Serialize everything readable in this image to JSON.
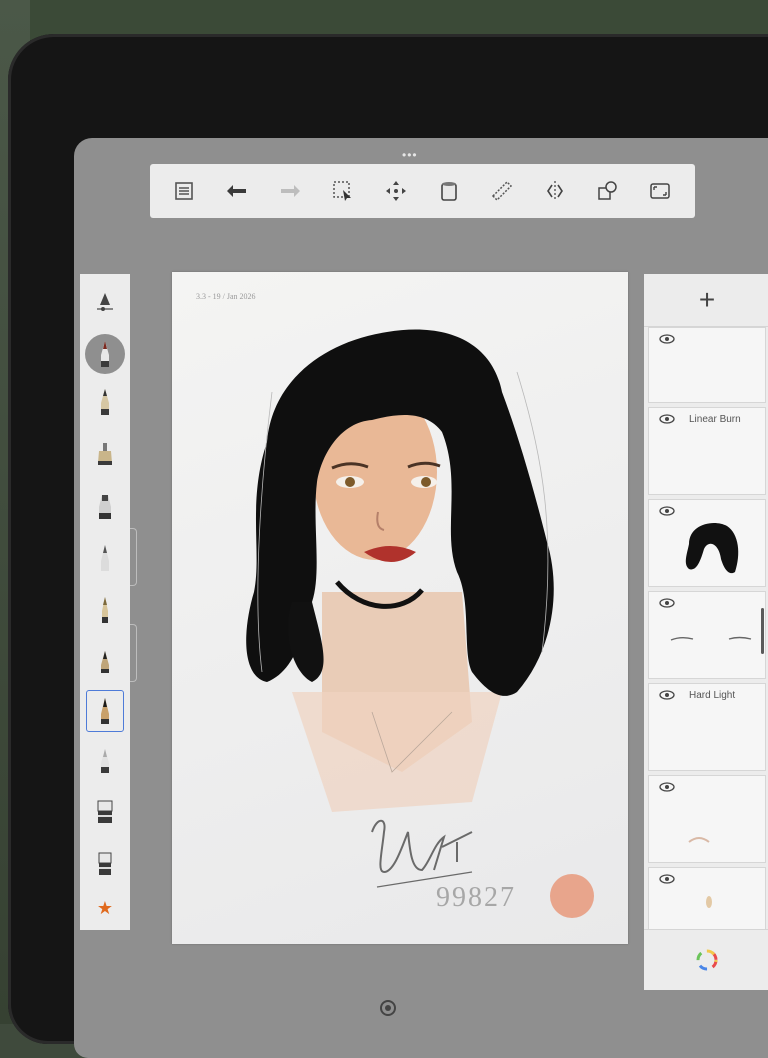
{
  "app": {
    "grab_indicator": "•••"
  },
  "toolbar": {
    "items": [
      {
        "name": "lists-icon"
      },
      {
        "name": "undo-icon"
      },
      {
        "name": "redo-icon"
      },
      {
        "name": "selection-icon"
      },
      {
        "name": "transform-icon"
      },
      {
        "name": "fill-bucket-icon"
      },
      {
        "name": "ruler-icon"
      },
      {
        "name": "symmetry-icon"
      },
      {
        "name": "shapes-icon"
      },
      {
        "name": "fullscreen-icon"
      }
    ]
  },
  "brushes": {
    "items": [
      "brush-settings",
      "pencil-active",
      "pencil",
      "airbrush",
      "marker",
      "pen",
      "ballpoint",
      "paint-brush",
      "inking-brush-selected",
      "smudge",
      "eraser",
      "bucket-eraser"
    ],
    "favorite_icon": "star-icon"
  },
  "canvas": {
    "date_note": "3.3 - 19 / Jan 2026",
    "signature": "Urs",
    "signature_number": "99827",
    "swatch_color": "#e8a58c"
  },
  "layers": {
    "add_label": "+",
    "items": [
      {
        "mode": "",
        "thumb": "blank"
      },
      {
        "mode": "Linear Burn",
        "thumb": "blank"
      },
      {
        "mode": "",
        "thumb": "hair"
      },
      {
        "mode": "",
        "thumb": "brows"
      },
      {
        "mode": "Hard Light",
        "thumb": "blank"
      },
      {
        "mode": "",
        "thumb": "faint"
      },
      {
        "mode": "",
        "thumb": "faint"
      }
    ],
    "color_button_icon": "color-wheel-icon"
  },
  "bottom_bar": {
    "icon": "canvas-menu-icon"
  }
}
